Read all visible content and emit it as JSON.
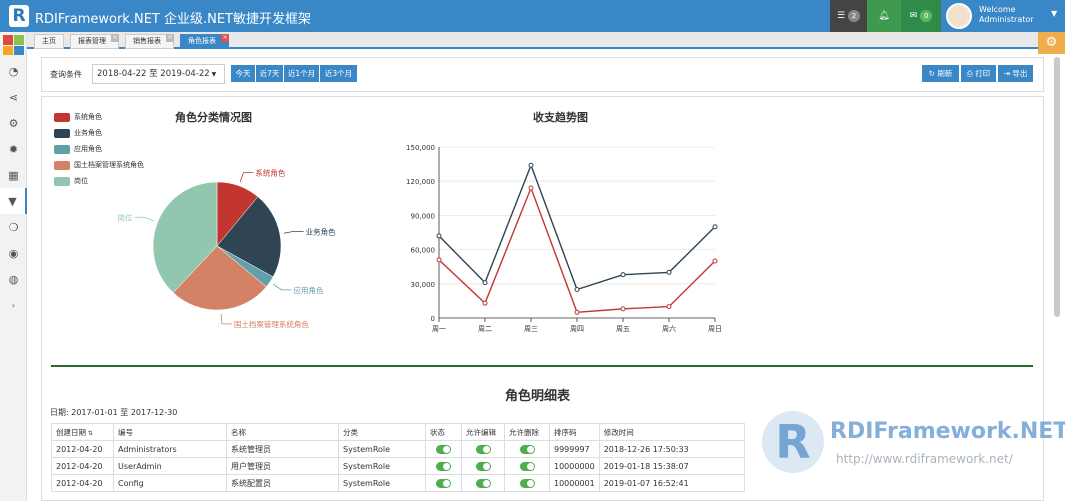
{
  "app": {
    "title": "RDIFramework.NET 企业级.NET敏捷开发框架",
    "logo": "R"
  },
  "topbar": {
    "list_count": "2",
    "mail_count": "0",
    "welcome": "Welcome",
    "user": "Administrator",
    "icons": [
      "list-icon",
      "bell-icon",
      "mail-icon",
      "chevron-down-icon"
    ]
  },
  "sidebar": {
    "icons": [
      "dashboard-icon",
      "share-icon",
      "cogs-icon",
      "bug-icon",
      "calendar-icon",
      "filter-icon",
      "wechat-icon",
      "eye-icon",
      "globe-icon",
      "expand-icon"
    ]
  },
  "tabs": [
    {
      "label": "主页"
    },
    {
      "label": "报表管理"
    },
    {
      "label": "销售报表"
    },
    {
      "label": "角色报表"
    }
  ],
  "filter": {
    "label": "查询条件",
    "date_range": "2018-04-22 至 2019-04-22",
    "quick": [
      "今天",
      "近7天",
      "近1个月",
      "近3个月"
    ],
    "actions": [
      "刷新",
      "打印",
      "导出"
    ]
  },
  "colors": {
    "accent": "#3a87c8",
    "red": "#c23531",
    "navy": "#2f4554",
    "teal": "#61a0a8",
    "salmon": "#d48265",
    "mint": "#91c7ae"
  },
  "pie_chart": {
    "title": "角色分类情况图",
    "type": "pie",
    "slices": [
      {
        "name": "系统角色",
        "value": 11,
        "color": "#c23531"
      },
      {
        "name": "业务角色",
        "value": 22,
        "color": "#2f4554"
      },
      {
        "name": "应用角色",
        "value": 3,
        "color": "#61a0a8"
      },
      {
        "name": "国土档案管理系统角色",
        "value": 26,
        "color": "#d48265"
      },
      {
        "name": "岗位",
        "value": 38,
        "color": "#91c7ae"
      }
    ]
  },
  "chart_data": {
    "type": "line",
    "title": "收支趋势图",
    "categories": [
      "周一",
      "周二",
      "周三",
      "周四",
      "周五",
      "周六",
      "周日"
    ],
    "yticks": [
      "0",
      "30,000",
      "60,000",
      "90,000",
      "120,000",
      "150,000"
    ],
    "ylim": [
      0,
      150000
    ],
    "series": [
      {
        "color": "#2f4554",
        "values": [
          72000,
          31000,
          134000,
          25000,
          38000,
          40000,
          80000
        ]
      },
      {
        "color": "#c23531",
        "values": [
          51000,
          13000,
          114000,
          5000,
          8000,
          10000,
          50000
        ]
      }
    ]
  },
  "table": {
    "title": "角色明细表",
    "date_hint": "日期: 2017-01-01 至 2017-12-30",
    "headers": [
      "创建日期",
      "编号",
      "名称",
      "分类",
      "状态",
      "允许编辑",
      "允许删除",
      "排序码",
      "修改时间"
    ],
    "rows": [
      [
        "2012-04-20",
        "Administrators",
        "系统管理员",
        "SystemRole",
        "9999997",
        "2018-12-26 17:50:33"
      ],
      [
        "2012-04-20",
        "UserAdmin",
        "用户管理员",
        "SystemRole",
        "10000000",
        "2019-01-18 15:38:07"
      ],
      [
        "2012-04-20",
        "Config",
        "系统配置员",
        "SystemRole",
        "10000001",
        "2019-01-07 16:52:41"
      ]
    ]
  },
  "watermark": {
    "text": "RDIFramework.NET",
    "url": "http://www.rdiframework.net/"
  }
}
